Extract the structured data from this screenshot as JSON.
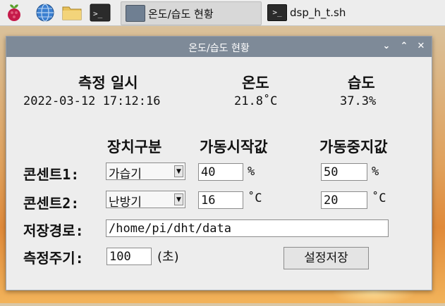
{
  "taskbar": {
    "tasks": [
      {
        "label": "온도/습도 현황"
      },
      {
        "label": "dsp_h_t.sh"
      }
    ]
  },
  "window": {
    "title": "온도/습도 현황",
    "controls": {
      "minimize": "⌄",
      "maximize": "⌃",
      "close": "✕"
    }
  },
  "readings": {
    "date_header": "측정 일시",
    "temp_header": "온도",
    "humid_header": "습도",
    "date_value": "2022-03-12 17:12:16",
    "temp_value": "21.8˚C",
    "humid_value": "37.3%"
  },
  "settings": {
    "col_device": "장치구분",
    "col_start": "가동시작값",
    "col_stop": "가동중지값",
    "outlet1": {
      "label": "콘센트1:",
      "device": "가습기",
      "start": "40",
      "start_unit": "%",
      "stop": "50",
      "stop_unit": "%"
    },
    "outlet2": {
      "label": "콘센트2:",
      "device": "난방기",
      "start": "16",
      "start_unit": "˚C",
      "stop": "20",
      "stop_unit": "˚C"
    },
    "path_label": "저장경로:",
    "path_value": "/home/pi/dht/data",
    "interval_label": "측정주기:",
    "interval_value": "100",
    "interval_unit": "(초)",
    "save_button": "설정저장"
  }
}
